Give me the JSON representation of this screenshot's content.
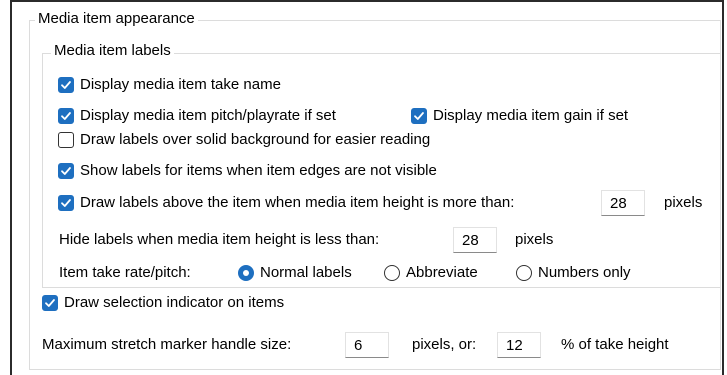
{
  "groups": {
    "appearance_title": "Media item appearance",
    "labels_title": "Media item labels"
  },
  "options": {
    "take_name": {
      "label": "Display media item take name",
      "checked": true
    },
    "pitch_rate": {
      "label": "Display media item pitch/playrate if set",
      "checked": true
    },
    "gain": {
      "label": "Display media item gain if set",
      "checked": true
    },
    "solid_bg": {
      "label": "Draw labels over solid background for easier reading",
      "checked": false
    },
    "edges_hidden": {
      "label": "Show labels for items when item edges are not visible",
      "checked": true
    },
    "above_item": {
      "label": "Draw labels above the item when media item height is more than:",
      "checked": true,
      "value": "28",
      "unit": "pixels"
    },
    "hide_labels": {
      "label": "Hide labels when media item height is less than:",
      "value": "28",
      "unit": "pixels"
    },
    "take_rate": {
      "label": "Item take rate/pitch:",
      "options": [
        "Normal labels",
        "Abbreviate",
        "Numbers only"
      ],
      "selected": "Normal labels"
    },
    "selection_indicator": {
      "label": "Draw selection indicator on items",
      "checked": true
    },
    "stretch_marker": {
      "label": "Maximum stretch marker handle size:",
      "pixels_value": "6",
      "pixels_unit": "pixels, or:",
      "percent_value": "12",
      "percent_unit": "% of take height"
    }
  },
  "colors": {
    "accent": "#1e6fc0",
    "frame": "#2b2b2b",
    "group_border": "#dcdcdc"
  }
}
